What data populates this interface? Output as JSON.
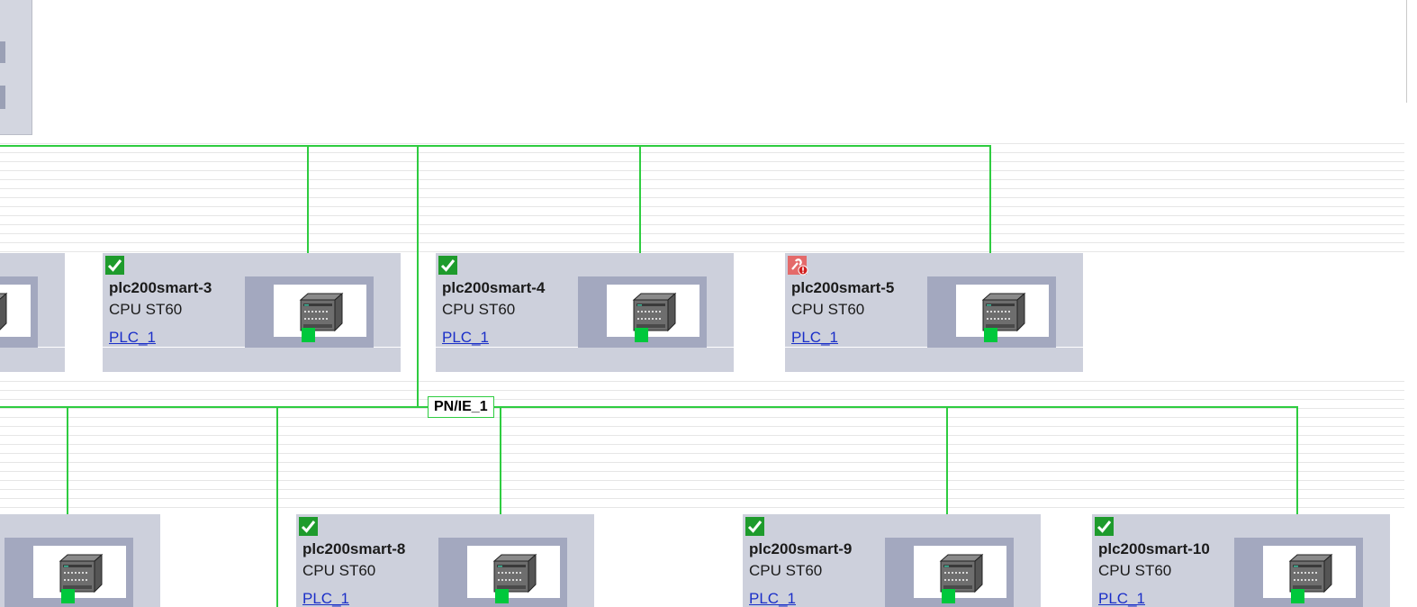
{
  "network": {
    "label": "PN/IE_1"
  },
  "colors": {
    "wire": "#2ecc40",
    "port": "#00c83c",
    "device_bg": "#cdd0dc",
    "slot_bg": "#a3a8bf",
    "link": "#1a2ec8"
  },
  "devices": [
    {
      "name": "",
      "cpu": "",
      "plc": "",
      "status": "none"
    },
    {
      "name": "plc200smart-3",
      "cpu": "CPU ST60",
      "plc": "PLC_1",
      "status": "ok"
    },
    {
      "name": "plc200smart-4",
      "cpu": "CPU ST60",
      "plc": "PLC_1",
      "status": "ok"
    },
    {
      "name": "plc200smart-5",
      "cpu": "CPU ST60",
      "plc": "PLC_1",
      "status": "error"
    },
    {
      "name": "",
      "cpu": "",
      "plc": "",
      "status": "none"
    },
    {
      "name": "plc200smart-8",
      "cpu": "CPU ST60",
      "plc": "PLC_1",
      "status": "ok"
    },
    {
      "name": "plc200smart-9",
      "cpu": "CPU ST60",
      "plc": "PLC_1",
      "status": "ok"
    },
    {
      "name": "plc200smart-10",
      "cpu": "CPU ST60",
      "plc": "PLC_1",
      "status": "ok"
    }
  ]
}
